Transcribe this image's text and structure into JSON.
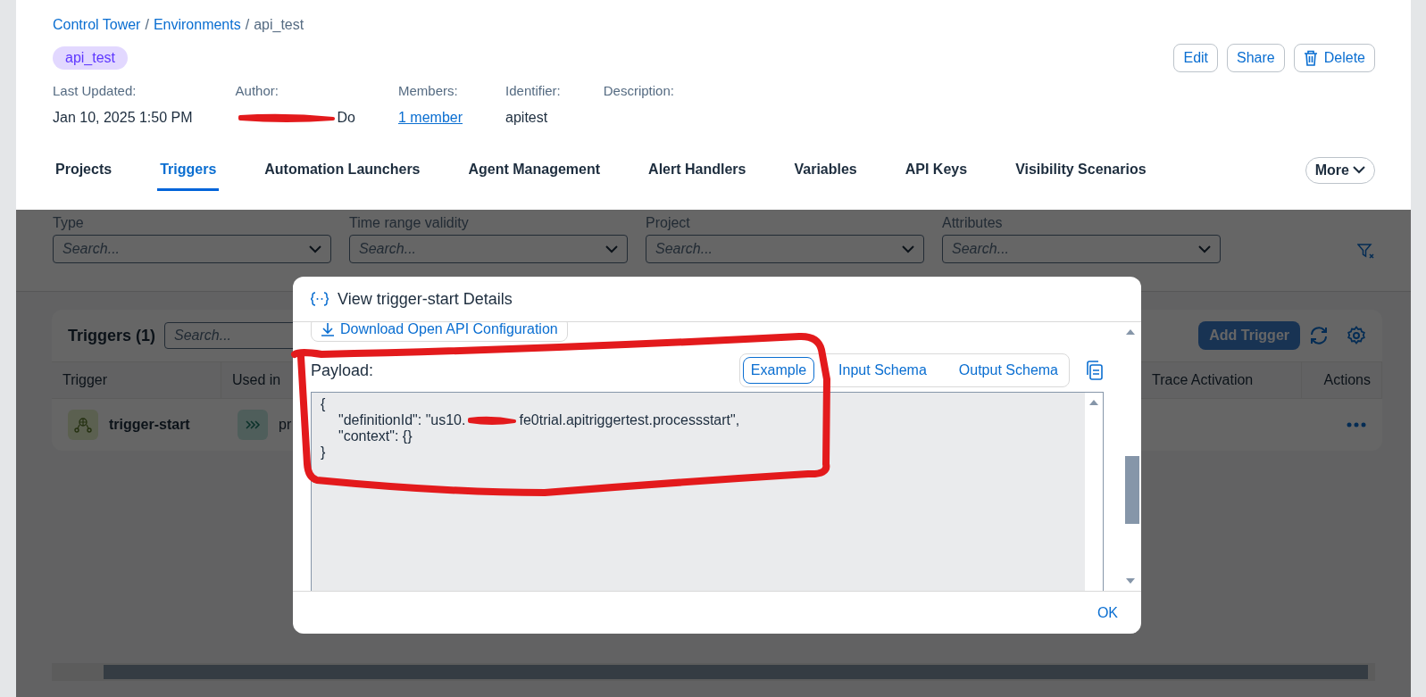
{
  "breadcrumb": [
    {
      "label": "Control Tower",
      "kind": "link"
    },
    {
      "label": "/",
      "kind": "separator"
    },
    {
      "label": "Environments",
      "kind": "link"
    },
    {
      "label": "/",
      "kind": "separator"
    },
    {
      "label": "api_test",
      "kind": "current"
    }
  ],
  "tag": "api_test",
  "actions": [
    {
      "label": "Edit",
      "kind": "plain"
    },
    {
      "label": "Share",
      "kind": "plain"
    },
    {
      "label": "Delete",
      "kind": "trash"
    }
  ],
  "meta": [
    {
      "label": "Last Updated:",
      "value": "Jan 10, 2025 1:50 PM",
      "kind": "text"
    },
    {
      "label": "Author:",
      "value": "Do",
      "kind": "redacted"
    },
    {
      "label": "Members:",
      "value": "1 member",
      "kind": "link"
    },
    {
      "label": "Identifier:",
      "value": "apitest",
      "kind": "text"
    },
    {
      "label": "Description:"
    }
  ],
  "tabs": [
    {
      "label": "Projects",
      "selected": false
    },
    {
      "label": "Triggers",
      "selected": true
    },
    {
      "label": "Automation Launchers",
      "selected": false
    },
    {
      "label": "Agent Management",
      "selected": false
    },
    {
      "label": "Alert Handlers",
      "selected": false
    },
    {
      "label": "Variables",
      "selected": false
    },
    {
      "label": "API Keys",
      "selected": false
    },
    {
      "label": "Visibility Scenarios",
      "selected": false
    }
  ],
  "more_button": "More",
  "filters": [
    {
      "label": "Type",
      "placeholder": "Search..."
    },
    {
      "label": "Time range validity",
      "placeholder": "Search..."
    },
    {
      "label": "Project",
      "placeholder": "Search..."
    },
    {
      "label": "Attributes",
      "placeholder": "Search..."
    }
  ],
  "triggers": {
    "title": "Triggers (1)",
    "search_placeholder": "Search...",
    "add_button": "Add Trigger",
    "add_disabled": true,
    "columns": [
      "Trigger",
      "Used in",
      "Trace Activation",
      "Actions"
    ],
    "rows": [
      {
        "trigger": "trigger-start",
        "used_in": "pr"
      }
    ]
  },
  "dialog": {
    "title": "View trigger-start Details",
    "download": "Download Open API Configuration",
    "payload_label": "Payload:",
    "tabs": [
      {
        "label": "Example",
        "selected": true
      },
      {
        "label": "Input Schema",
        "selected": false
      },
      {
        "label": "Output Schema",
        "selected": false
      }
    ],
    "code_lines": [
      {
        "segments": [
          "{"
        ]
      },
      {
        "segments": [
          "\"definitionId\": \"us10.",
          "fe0trial.apitriggertest.processstart\","
        ],
        "redacted": true
      },
      {
        "segments": [
          "\"context\": {}"
        ]
      },
      {
        "segments": [
          "}"
        ]
      }
    ],
    "ok": "OK"
  }
}
